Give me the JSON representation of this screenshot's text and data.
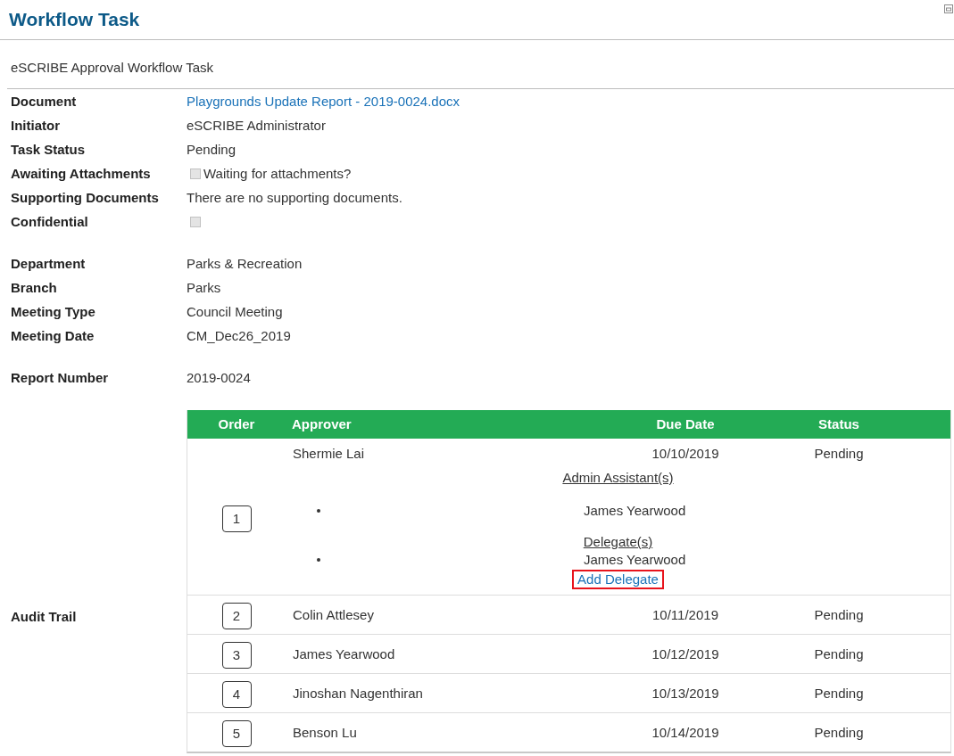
{
  "window": {
    "title": "Workflow Task"
  },
  "subtitle": "eSCRIBE Approval Workflow Task",
  "sections": [
    {
      "fields": [
        {
          "label": "Document",
          "kind": "link",
          "value": "Playgrounds Update Report - 2019-0024.docx"
        },
        {
          "label": "Initiator",
          "kind": "text",
          "value": "eSCRIBE Administrator"
        },
        {
          "label": "Task Status",
          "kind": "text",
          "value": "Pending"
        },
        {
          "label": "Awaiting Attachments",
          "kind": "checkbox",
          "checked": false,
          "value": "Waiting for attachments?"
        },
        {
          "label": "Supporting Documents",
          "kind": "text",
          "value": "There are no supporting documents."
        },
        {
          "label": "Confidential",
          "kind": "checkbox",
          "checked": false
        }
      ]
    },
    {
      "fields": [
        {
          "label": "Department",
          "kind": "text",
          "value": "Parks & Recreation"
        },
        {
          "label": "Branch",
          "kind": "text",
          "value": "Parks"
        },
        {
          "label": "Meeting Type",
          "kind": "text",
          "value": "Council Meeting"
        },
        {
          "label": "Meeting Date",
          "kind": "text",
          "value": "CM_Dec26_2019"
        }
      ]
    },
    {
      "fields": [
        {
          "label": "Report Number",
          "kind": "text",
          "value": "2019-0024"
        }
      ]
    }
  ],
  "audit_trail": {
    "label": "Audit Trail",
    "columns": [
      "Order",
      "Approver",
      "Due Date",
      "Status"
    ],
    "rows": [
      {
        "order": "1",
        "approver": "Shermie Lai",
        "due_date": "10/10/2019",
        "status": "Pending",
        "admin_assistants": {
          "heading": "Admin Assistant(s)",
          "names": [
            "James Yearwood"
          ]
        },
        "delegates": {
          "heading": "Delegate(s)",
          "names": [
            "James Yearwood"
          ]
        },
        "add_delegate": {
          "label": "Add Delegate",
          "highlighted": true
        }
      },
      {
        "order": "2",
        "approver": "Colin Attlesey",
        "due_date": "10/11/2019",
        "status": "Pending"
      },
      {
        "order": "3",
        "approver": "James Yearwood",
        "due_date": "10/12/2019",
        "status": "Pending"
      },
      {
        "order": "4",
        "approver": "Jinoshan Nagenthiran",
        "due_date": "10/13/2019",
        "status": "Pending"
      },
      {
        "order": "5",
        "approver": "Benson Lu",
        "due_date": "10/14/2019",
        "status": "Pending"
      }
    ]
  }
}
